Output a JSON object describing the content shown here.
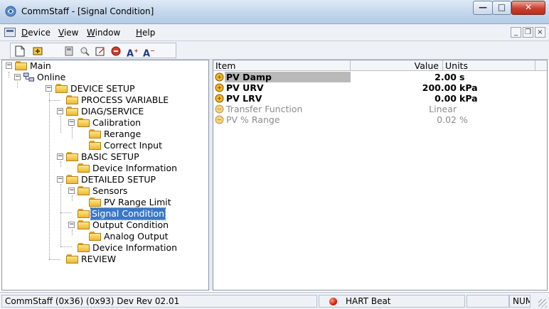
{
  "window": {
    "title": "CommStaff - [Signal Condition]",
    "app_icon": "commstaff-app-icon",
    "caption_buttons": {
      "minimize": "—",
      "maximize": "□",
      "close": "✕"
    }
  },
  "menubar": {
    "items": [
      {
        "label": "Device",
        "accel": "D"
      },
      {
        "label": "View",
        "accel": "V"
      },
      {
        "label": "Window",
        "accel": "W"
      },
      {
        "label": "Help",
        "accel": "H"
      }
    ],
    "mdi_buttons": {
      "minimize": "_",
      "restore": "❐",
      "close": "×"
    }
  },
  "toolbar": {
    "icons": [
      "new-document-icon",
      "connect-icon",
      "device-icon",
      "search-device-icon",
      "edit-icon",
      "stop-icon",
      "font-increase-icon",
      "font-decrease-icon"
    ]
  },
  "tree": {
    "nodes": [
      {
        "label": "Main",
        "expanded": true
      },
      {
        "label": "Online",
        "expanded": true
      },
      {
        "label": "DEVICE SETUP",
        "expanded": true
      },
      {
        "label": "PROCESS VARIABLE"
      },
      {
        "label": "DIAG/SERVICE",
        "expanded": true
      },
      {
        "label": "Calibration",
        "expanded": true
      },
      {
        "label": "Rerange"
      },
      {
        "label": "Correct Input"
      },
      {
        "label": "BASIC SETUP",
        "expanded": true
      },
      {
        "label": "Device Information"
      },
      {
        "label": "DETAILED SETUP",
        "expanded": true
      },
      {
        "label": "Sensors",
        "expanded": true
      },
      {
        "label": "PV Range Limit"
      },
      {
        "label": "Signal Condition",
        "selected": true
      },
      {
        "label": "Output Condition",
        "expanded": true
      },
      {
        "label": "Analog Output"
      },
      {
        "label": "Device Information"
      },
      {
        "label": "REVIEW"
      }
    ]
  },
  "list": {
    "columns": {
      "item": "Item",
      "value": "Value",
      "units": "Units"
    },
    "rows": [
      {
        "item": "PV Damp",
        "value": "2.00",
        "units": "s",
        "style": "bold",
        "highlight": true
      },
      {
        "item": "PV URV",
        "value": "200.00",
        "units": "kPa",
        "style": "bold"
      },
      {
        "item": "PV LRV",
        "value": "0.00",
        "units": "kPa",
        "style": "bold"
      },
      {
        "item": "Transfer Function",
        "value": "Linear",
        "units": "",
        "style": "dim"
      },
      {
        "item": "PV % Range",
        "value": "0.02",
        "units": "%",
        "style": "dim"
      }
    ]
  },
  "statusbar": {
    "device_info": "CommStaff  (0x36)  (0x93) Dev Rev 02.01",
    "hart_label": "HART Beat",
    "num_lock": "NUM"
  },
  "colors": {
    "selection": "#3a78c6",
    "folder": "#f0b72c",
    "hart_led": "#d6200c"
  }
}
